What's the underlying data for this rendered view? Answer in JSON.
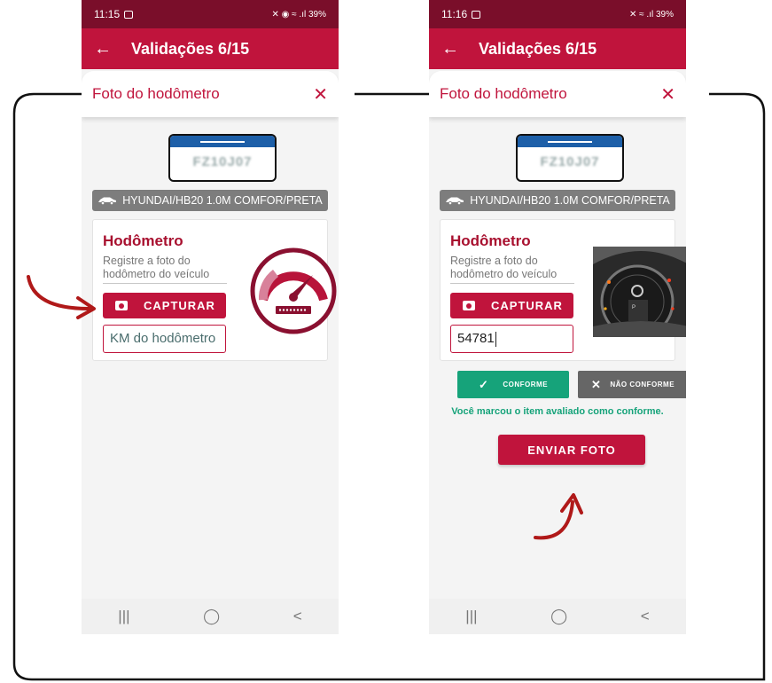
{
  "accent_color": "#c0143c",
  "status_bar_color": "#7a0e2a",
  "success_color": "#16a37a",
  "left_phone": {
    "time": "11:15",
    "status_icons": "✕ ◉ ≈ .ıl 39%",
    "header_title": "Validações 6/15",
    "sheet_title": "Foto do hodômetro",
    "plate_text": "FZ10J07",
    "vehicle": "HYUNDAI/HB20 1.0M COMFOR/PRETA",
    "card_title": "Hodômetro",
    "card_subtitle": "Registre a foto do hodômetro do veículo",
    "capture_label": "CAPTURAR",
    "km_placeholder": "KM do hodômetro",
    "nav_recent": "|||",
    "nav_home": "◯",
    "nav_back": "<"
  },
  "right_phone": {
    "time": "11:16",
    "status_icons": "✕ ≈ .ıl 39%",
    "header_title": "Validações 6/15",
    "sheet_title": "Foto do hodômetro",
    "plate_text": "FZ10J07",
    "vehicle": "HYUNDAI/HB20 1.0M COMFOR/PRETA",
    "card_title": "Hodômetro",
    "card_subtitle": "Registre a foto do hodômetro do veículo",
    "capture_label": "CAPTURAR",
    "km_value": "54781",
    "conforme_label": "CONFORME",
    "nao_conforme_label": "NÃO CONFORME",
    "conforme_message": "Você marcou o item avaliado como conforme.",
    "send_label": "ENVIAR FOTO",
    "nav_recent": "|||",
    "nav_home": "◯",
    "nav_back": "<"
  }
}
